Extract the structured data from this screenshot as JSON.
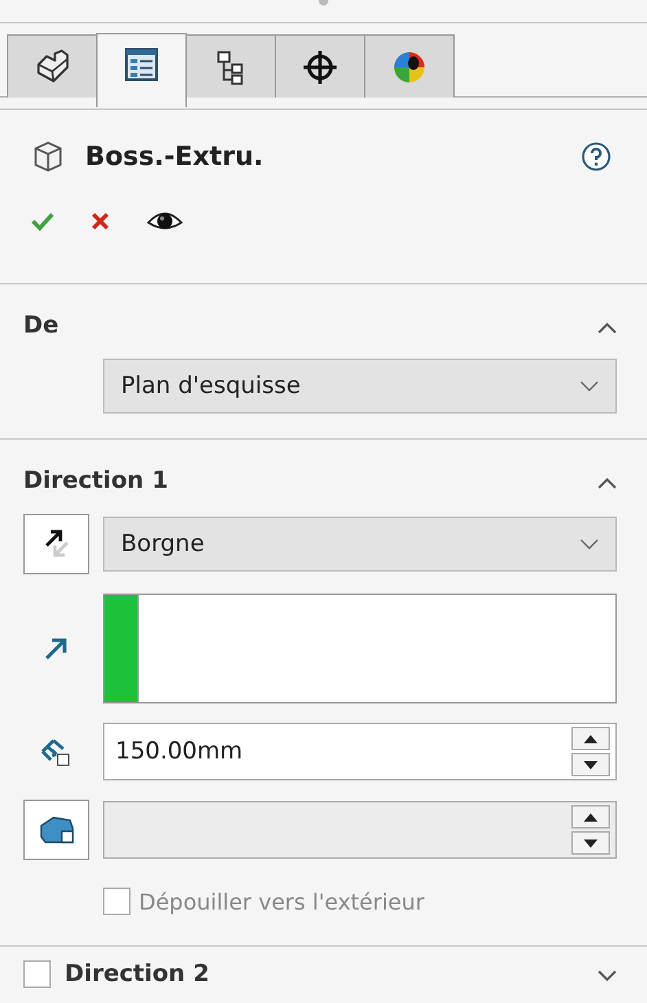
{
  "tabs": [
    {
      "selected": false
    },
    {
      "selected": true
    },
    {
      "selected": false
    },
    {
      "selected": false
    },
    {
      "selected": false
    }
  ],
  "header": {
    "title": "Boss.-Extru."
  },
  "sections": [
    {
      "kind": "from",
      "title": "De",
      "expanded": true,
      "select": "Plan d'esquisse"
    },
    {
      "kind": "direction",
      "title": "Direction 1",
      "expanded": true,
      "select": "Borgne",
      "depth": "150.00mm",
      "draft": {
        "label": "Dépouiller vers l'extérieur",
        "checked": false,
        "disabled": true
      }
    },
    {
      "kind": "optional",
      "title": "Direction 2",
      "expanded": false,
      "checked": false
    }
  ]
}
